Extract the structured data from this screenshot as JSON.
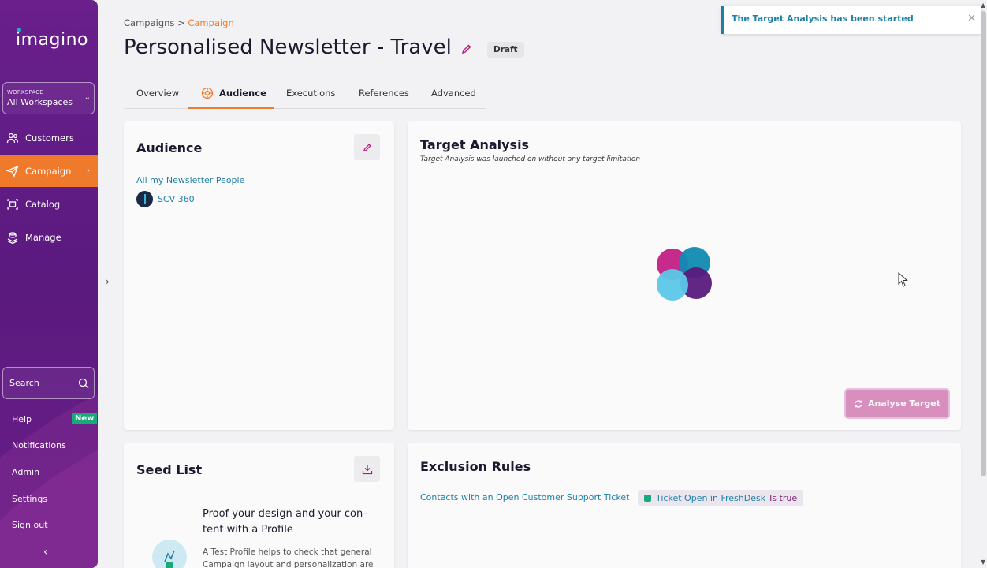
{
  "app": {
    "logo_text": "imagino"
  },
  "sidebar": {
    "workspace_label": "WORKSPACE",
    "workspace_value": "All Workspaces",
    "items": [
      {
        "label": "Customers",
        "icon": "users-icon"
      },
      {
        "label": "Campaign",
        "icon": "paper-plane-icon",
        "active": true
      },
      {
        "label": "Catalog",
        "icon": "catalog-icon"
      },
      {
        "label": "Manage",
        "icon": "stack-icon"
      }
    ],
    "search_placeholder": "Search",
    "help_label": "Help",
    "new_badge": "New",
    "notifications_label": "Notifications",
    "admin_label": "Admin",
    "settings_label": "Settings",
    "signout_label": "Sign out"
  },
  "breadcrumb": {
    "root": "Campaigns",
    "separator": ">",
    "current": "Campaign"
  },
  "page": {
    "title": "Personalised Newsletter - Travel",
    "status": "Draft"
  },
  "tabs": [
    "Overview",
    "Audience",
    "Executions",
    "References",
    "Advanced"
  ],
  "audience": {
    "title": "Audience",
    "segment_link": "All my Newsletter People",
    "source_name": "SCV 360"
  },
  "target_analysis": {
    "title": "Target Analysis",
    "subtitle": "Target Analysis was launched on without any target limitation",
    "button_label": "Analyse Target"
  },
  "seed_list": {
    "title": "Seed List",
    "headline": "Proof your design and your con- tent with a Profile",
    "headline_line1": "Proof your design and your con-",
    "headline_line2": "tent with a Profile",
    "body_line1": "A Test Profile helps to check that general",
    "body_line2": "Campaign layout and personalization are"
  },
  "exclusion_rules": {
    "title": "Exclusion Rules",
    "rule_link": "Contacts with an Open Customer Support Ticket",
    "tag_name": "Ticket Open in FreshDesk",
    "tag_operator": "Is true"
  },
  "toast": {
    "message": "The Target Analysis has been started"
  },
  "colors": {
    "accent": "#f07a2c",
    "sidebar": "#5a1a7e",
    "link": "#1f7fa6",
    "magenta": "#c0137e"
  }
}
